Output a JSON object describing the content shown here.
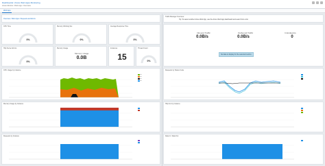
{
  "topbar": {
    "crumb": "Dashboards / Azure Web Apps Monitoring",
    "sub": "Azure Monitor / Web App / Overview"
  },
  "tab": {
    "label": "Web App"
  },
  "left": {
    "app_link": "Overview / Web Apps / Requests and Errors",
    "gauges": [
      {
        "title": "CPU Time",
        "value": "0%"
      },
      {
        "title": "Memory Working Set",
        "value": "0%"
      },
      {
        "title": "Average Response Time",
        "value": "0%"
      }
    ],
    "row2_gauge": {
      "title": "Http Server Errors",
      "value": "0%"
    },
    "memory": {
      "title": "Memory Usage",
      "value": "0.0B",
      "sub": "Memory Usage"
    },
    "count": {
      "title": "Instances",
      "value": "15"
    },
    "row2_gauge2": {
      "title": "Thread Count",
      "value": "0%"
    },
    "charts": [
      {
        "title": "CPU Usage by Instance"
      },
      {
        "title": "Memory Usage by Instance"
      },
      {
        "title": "Requests by Instance"
      }
    ]
  },
  "right": {
    "header": "Traffic Manager Overview",
    "intro": "Tip: To select another Azure Web App, use the Azure Web App dashboard and select from a list.",
    "inbound": {
      "title": "Inbound Traffic",
      "value": "0.0B/s"
    },
    "outbound": {
      "title": "Outbound Traffic",
      "value": "0.0B/s"
    },
    "endpoints": {
      "title": "In Endpoints",
      "value": "0"
    },
    "notice": "No data to display for the selected metrics",
    "charts": [
      {
        "title": "Requests by Status Code"
      },
      {
        "title": "Http 4xx by Instance"
      },
      {
        "title": "Data In / Data Out"
      }
    ]
  },
  "colors": {
    "green": "#6fb900",
    "orange": "#e8720c",
    "blue": "#1e90e6",
    "black": "#111111",
    "cyan": "#2ab7d4"
  }
}
